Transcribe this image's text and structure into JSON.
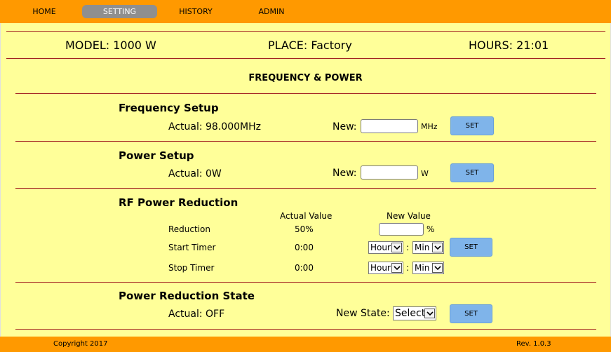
{
  "nav": {
    "home": "HOME",
    "setting": "SETTING",
    "history": "HISTORY",
    "admin": "ADMIN"
  },
  "info": {
    "model": "MODEL: 1000 W",
    "place": "PLACE: Factory",
    "hours": "HOURS: 21:01"
  },
  "page_title": "FREQUENCY & POWER",
  "frequency": {
    "title": "Frequency Setup",
    "actual": "Actual: 98.000MHz",
    "new_label": "New:",
    "new_value": "",
    "unit": "MHz",
    "set": "SET"
  },
  "power": {
    "title": "Power Setup",
    "actual": "Actual: 0W",
    "new_label": "New:",
    "new_value": "",
    "unit": "W",
    "set": "SET"
  },
  "rf": {
    "title": "RF Power Reduction",
    "col_actual": "Actual Value",
    "col_new": "New Value",
    "reduction_label": "Reduction",
    "reduction_actual": "50%",
    "reduction_unit": "%",
    "start_label": "Start Timer",
    "start_actual": "0:00",
    "stop_label": "Stop Timer",
    "stop_actual": "0:00",
    "hour_select": "Hour",
    "min_select": "Min",
    "colon": ":",
    "set": "SET"
  },
  "state": {
    "title": "Power Reduction State",
    "actual": "Actual: OFF",
    "new_label": "New State:",
    "select": "Select",
    "set": "SET"
  },
  "footer": {
    "copyright": "Copyright 2017",
    "rev": "Rev. 1.0.3"
  },
  "colors": {
    "background": "#ffff99",
    "bar": "#ff9900",
    "button": "#7fb4ea",
    "rule": "#a11f1f"
  }
}
